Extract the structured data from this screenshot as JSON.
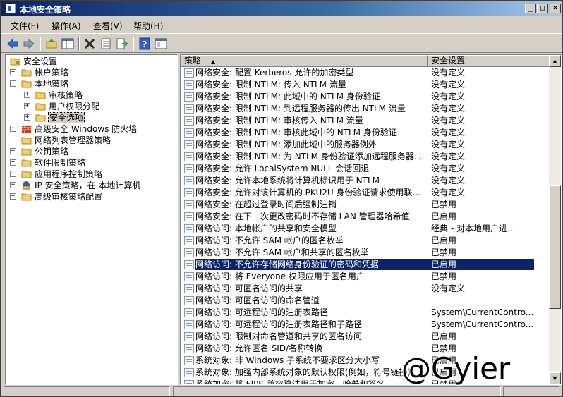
{
  "window": {
    "title": "本地安全策略"
  },
  "menu": [
    "文件(F)",
    "操作(A)",
    "查看(V)",
    "帮助(H)"
  ],
  "toolbar": [
    "back-arrow-icon",
    "forward-arrow-icon",
    "up-folder-icon",
    "show-hide-tree-icon",
    "delete-icon",
    "properties-icon",
    "export-list-icon",
    "help-icon",
    "console-tree-icon"
  ],
  "tree": [
    {
      "label": "安全设置",
      "level": 0,
      "expander": "",
      "icon": "security-settings-icon"
    },
    {
      "label": "帐户策略",
      "level": 1,
      "expander": "+",
      "icon": "folder-icon"
    },
    {
      "label": "本地策略",
      "level": 1,
      "expander": "-",
      "icon": "folder-icon"
    },
    {
      "label": "审核策略",
      "level": 2,
      "expander": "+",
      "icon": "folder-icon"
    },
    {
      "label": "用户权限分配",
      "level": 2,
      "expander": "+",
      "icon": "folder-icon"
    },
    {
      "label": "安全选项",
      "level": 2,
      "expander": "+",
      "icon": "folder-icon",
      "selected": true
    },
    {
      "label": "高级安全 Windows 防火墙",
      "level": 1,
      "expander": "+",
      "icon": "firewall-icon"
    },
    {
      "label": "网络列表管理器策略",
      "level": 1,
      "expander": "",
      "icon": "folder-icon"
    },
    {
      "label": "公钥策略",
      "level": 1,
      "expander": "+",
      "icon": "folder-icon"
    },
    {
      "label": "软件限制策略",
      "level": 1,
      "expander": "+",
      "icon": "folder-icon"
    },
    {
      "label": "应用程序控制策略",
      "level": 1,
      "expander": "+",
      "icon": "folder-icon"
    },
    {
      "label": "IP 安全策略，在 本地计算机",
      "level": 1,
      "expander": "+",
      "icon": "ip-security-icon"
    },
    {
      "label": "高级审核策略配置",
      "level": 1,
      "expander": "+",
      "icon": "folder-icon"
    }
  ],
  "columns": {
    "policy": "策略",
    "setting": "安全设置"
  },
  "rows": [
    {
      "name": "网络安全: 配置 Kerberos 允许的加密类型",
      "value": "没有定义"
    },
    {
      "name": "网络安全: 限制 NTLM: 传入 NTLM 流量",
      "value": "没有定义"
    },
    {
      "name": "网络安全: 限制 NTLM: 此域中的 NTLM 身份验证",
      "value": "没有定义"
    },
    {
      "name": "网络安全: 限制 NTLM: 到远程服务器的传出 NTLM 流量",
      "value": "没有定义"
    },
    {
      "name": "网络安全: 限制 NTLM: 审核传入 NTLM 流量",
      "value": "没有定义"
    },
    {
      "name": "网络安全: 限制 NTLM: 审核此域中的 NTLM 身份验证",
      "value": "没有定义"
    },
    {
      "name": "网络安全: 限制 NTLM: 添加此域中的服务器例外",
      "value": "没有定义"
    },
    {
      "name": "网络安全: 限制 NTLM: 为 NTLM 身份验证添加远程服务器...",
      "value": "没有定义"
    },
    {
      "name": "网络安全: 允许 LocalSystem NULL 会话回退",
      "value": "没有定义"
    },
    {
      "name": "网络安全: 允许本地系统将计算机标识用于 NTLM",
      "value": "没有定义"
    },
    {
      "name": "网络安全: 允许对该计算机的 PKU2U 身份验证请求使用联...",
      "value": "没有定义"
    },
    {
      "name": "网络安全: 在超过登录时间后强制注销",
      "value": "已禁用"
    },
    {
      "name": "网络安全: 在下一次更改密码时不存储 LAN 管理器哈希值",
      "value": "已启用"
    },
    {
      "name": "网络访问: 本地帐户的共享和安全模型",
      "value": "经典 - 对本地用户进..."
    },
    {
      "name": "网络访问: 不允许 SAM 帐户的匿名枚举",
      "value": "已启用"
    },
    {
      "name": "网络访问: 不允许 SAM 帐户和共享的匿名枚举",
      "value": "已禁用"
    },
    {
      "name": "网络访问: 不允许存储网络身份验证的密码和凭据",
      "value": "已启用",
      "selected": true
    },
    {
      "name": "网络访问: 将 Everyone 权限应用于匿名用户",
      "value": "已禁用"
    },
    {
      "name": "网络访问: 可匿名访问的共享",
      "value": "没有定义"
    },
    {
      "name": "网络访问: 可匿名访问的命名管道",
      "value": ""
    },
    {
      "name": "网络访问: 可远程访问的注册表路径",
      "value": "System\\CurrentContro..."
    },
    {
      "name": "网络访问: 可远程访问的注册表路径和子路径",
      "value": "System\\CurrentContro..."
    },
    {
      "name": "网络访问: 限制对命名管道和共享的匿名访问",
      "value": "已启用"
    },
    {
      "name": "网络访问: 允许匿名 SID/名称转换",
      "value": "已禁用"
    },
    {
      "name": "系统对象: 非 Windows 子系统不要求区分大小写",
      "value": "已启用"
    },
    {
      "name": "系统对象: 加强内部系统对象的默认权限(例如，符号链接)",
      "value": "已启用"
    },
    {
      "name": "系统加密: 将 FIPS 兼容算法用于加密，哈希和签名",
      "value": "已禁用"
    }
  ],
  "watermark": "@Gyier"
}
